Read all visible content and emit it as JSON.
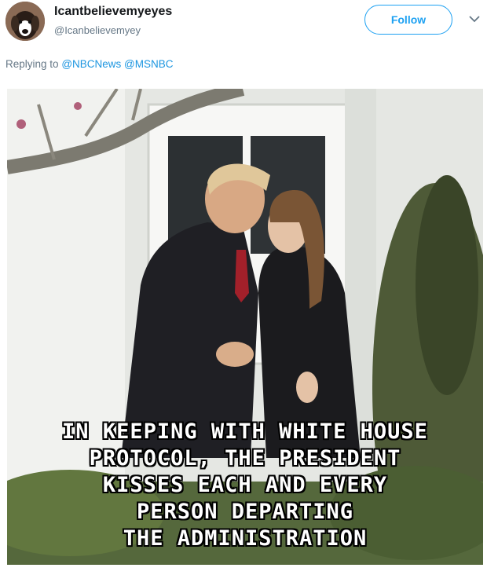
{
  "tweet": {
    "display_name": "Icantbelievemyeyes",
    "handle": "@Icanbelievemyey",
    "follow_label": "Follow",
    "reply_prefix": "Replying to",
    "reply_mentions": [
      "@NBCNews",
      "@MSNBC"
    ]
  },
  "media": {
    "caption_lines": [
      "IN KEEPING WITH WHITE HOUSE",
      "PROTOCOL, THE PRESIDENT",
      "KISSES EACH AND EVERY",
      "PERSON DEPARTING",
      "THE ADMINISTRATION"
    ]
  },
  "colors": {
    "accent": "#1da1f2",
    "mention": "#1b95e0",
    "muted": "#657786"
  },
  "icons": {
    "more": "chevron-down-icon",
    "avatar": "dog-avatar-icon"
  }
}
